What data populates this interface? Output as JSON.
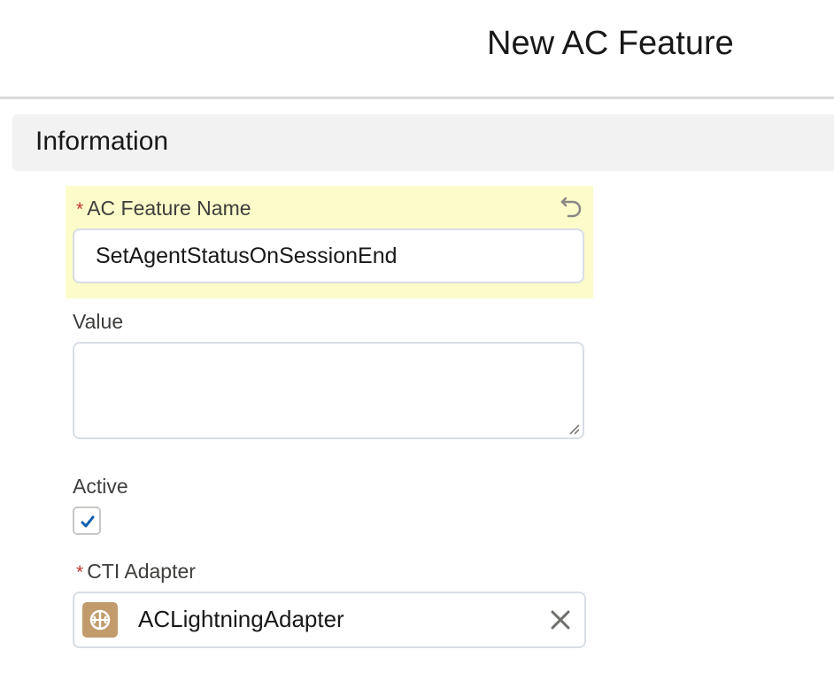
{
  "modal": {
    "title": "New AC Feature"
  },
  "section": {
    "title": "Information"
  },
  "fields": {
    "feature_name": {
      "required_marker": "*",
      "label": "AC Feature Name",
      "value": "SetAgentStatusOnSessionEnd",
      "icon": "undo-icon"
    },
    "value": {
      "label": "Value",
      "value": ""
    },
    "active": {
      "label": "Active",
      "checked": true
    },
    "cti_adapter": {
      "required_marker": "*",
      "label": "CTI Adapter",
      "value": "ACLightningAdapter",
      "icon": "call-center-icon",
      "clear_icon": "close-icon"
    }
  },
  "colors": {
    "highlight": "#fbfcc9",
    "required": "#c23934",
    "checkmark": "#0b5cab",
    "lookup_icon_bg": "#c19b6c",
    "section_bg": "#f3f2f2"
  }
}
